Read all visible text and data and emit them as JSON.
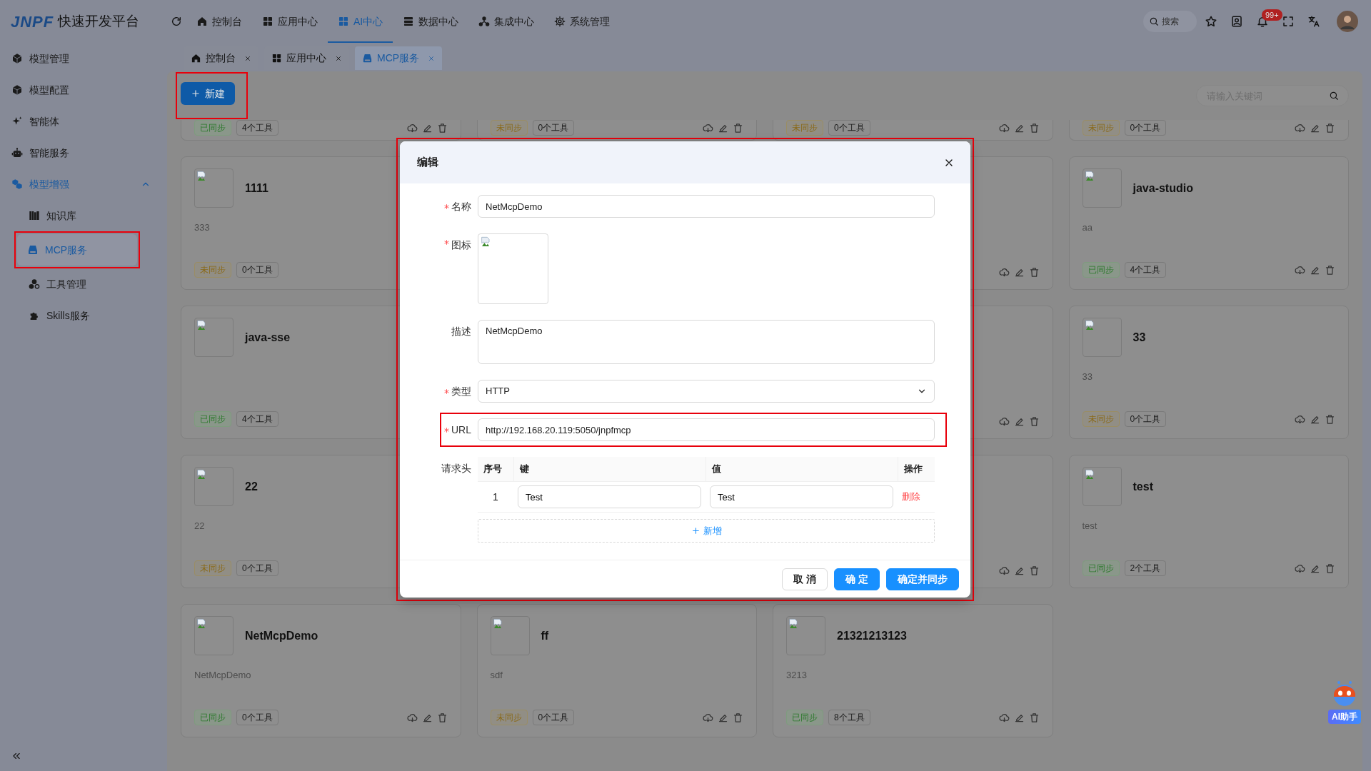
{
  "header": {
    "logo_mark": "JNPF",
    "logo_text": "快速开发平台",
    "nav": [
      {
        "label": "控制台",
        "selected": false
      },
      {
        "label": "应用中心",
        "selected": false
      },
      {
        "label": "AI中心",
        "selected": true
      },
      {
        "label": "数据中心",
        "selected": false
      },
      {
        "label": "集成中心",
        "selected": false
      },
      {
        "label": "系统管理",
        "selected": false
      }
    ],
    "search": {
      "placeholder": "搜索"
    },
    "notification_count": "99+"
  },
  "tabs": [
    {
      "label": "控制台",
      "selected": false
    },
    {
      "label": "应用中心",
      "selected": false
    },
    {
      "label": "MCP服务",
      "selected": true
    }
  ],
  "sidebar": {
    "items": [
      {
        "label": "模型管理",
        "active": false
      },
      {
        "label": "模型配置",
        "active": false
      },
      {
        "label": "智能体",
        "active": false
      },
      {
        "label": "智能服务",
        "active": false
      },
      {
        "label": "模型增强",
        "active": true,
        "expanded": true,
        "children": [
          {
            "label": "知识库",
            "selected": false,
            "highlighted": false
          },
          {
            "label": "MCP服务",
            "selected": true,
            "highlighted": true
          },
          {
            "label": "工具管理",
            "selected": false,
            "highlighted": false
          },
          {
            "label": "Skills服务",
            "selected": false,
            "highlighted": false
          }
        ]
      }
    ]
  },
  "toolbar": {
    "new_button": {
      "label": "新建",
      "highlighted": true
    },
    "search": {
      "placeholder": "请输入关键词"
    }
  },
  "card_rows": [
    [
      {
        "status": {
          "label": "已同步",
          "synced": true
        },
        "tools": "4个工具",
        "actions": true
      },
      {
        "status": {
          "label": "未同步",
          "synced": false
        },
        "tools": "0个工具",
        "actions": true
      },
      {
        "status": {
          "label": "未同步",
          "synced": false
        },
        "tools": "0个工具",
        "actions": true
      },
      {
        "status": {
          "label": "未同步",
          "synced": false
        },
        "tools": "0个工具",
        "actions": true
      }
    ],
    [
      {
        "title": "1111",
        "description": "333",
        "status": {
          "label": "未同步",
          "synced": false
        },
        "tools": "0个工具",
        "actions": false
      },
      null,
      {
        "actions": true
      },
      {
        "title": "java-studio",
        "description": "aa",
        "status": {
          "label": "已同步",
          "synced": true
        },
        "tools": "4个工具",
        "actions": true
      }
    ],
    [
      {
        "title": "java-sse",
        "status": {
          "label": "已同步",
          "synced": true
        },
        "tools": "4个工具",
        "actions": false
      },
      null,
      {
        "actions": true
      },
      {
        "title": "33",
        "description": "33",
        "status": {
          "label": "未同步",
          "synced": false
        },
        "tools": "0个工具",
        "actions": true
      }
    ],
    [
      {
        "title": "22",
        "description": "22",
        "status": {
          "label": "未同步",
          "synced": false
        },
        "tools": "0个工具",
        "actions": false
      },
      null,
      {
        "actions": true
      },
      {
        "title": "test",
        "description": "test",
        "status": {
          "label": "已同步",
          "synced": true
        },
        "tools": "2个工具",
        "actions": true
      }
    ],
    [
      {
        "title": "NetMcpDemo",
        "description": "NetMcpDemo",
        "status": {
          "label": "已同步",
          "synced": true
        },
        "tools": "0个工具",
        "actions": true
      },
      {
        "title": "ff",
        "description": "sdf",
        "status": {
          "label": "未同步",
          "synced": false
        },
        "tools": "0个工具",
        "actions": true
      },
      {
        "title": "21321213123",
        "description": "3213",
        "status": {
          "label": "已同步",
          "synced": true
        },
        "tools": "8个工具",
        "actions": true
      }
    ]
  ],
  "dialog": {
    "title": "编辑",
    "highlighted": true,
    "fields": [
      {
        "kind": "text",
        "label": "名称",
        "required": true,
        "highlighted": false,
        "value": "NetMcpDemo"
      },
      {
        "kind": "image",
        "label": "图标",
        "required": true,
        "highlighted": false
      },
      {
        "kind": "textarea",
        "label": "描述",
        "required": false,
        "highlighted": false,
        "value": "NetMcpDemo"
      },
      {
        "kind": "select",
        "label": "类型",
        "required": true,
        "highlighted": false,
        "value": "HTTP"
      },
      {
        "kind": "text",
        "label": "URL",
        "required": true,
        "highlighted": true,
        "value": "http://192.168.20.119:5050/jnpfmcp"
      },
      {
        "kind": "table",
        "label": "请求头",
        "required": false,
        "highlighted": false,
        "columns": [
          "序号",
          "键",
          "值",
          "操作"
        ],
        "rows": [
          {
            "index": "1",
            "key": "Test",
            "value": "Test",
            "action": "删除"
          }
        ],
        "add_label": "新增"
      }
    ],
    "buttons": [
      {
        "label": "取 消",
        "kind": "default"
      },
      {
        "label": "确 定",
        "kind": "primary"
      },
      {
        "label": "确定并同步",
        "kind": "primary"
      }
    ]
  },
  "assistant": {
    "label": "AI助手"
  }
}
